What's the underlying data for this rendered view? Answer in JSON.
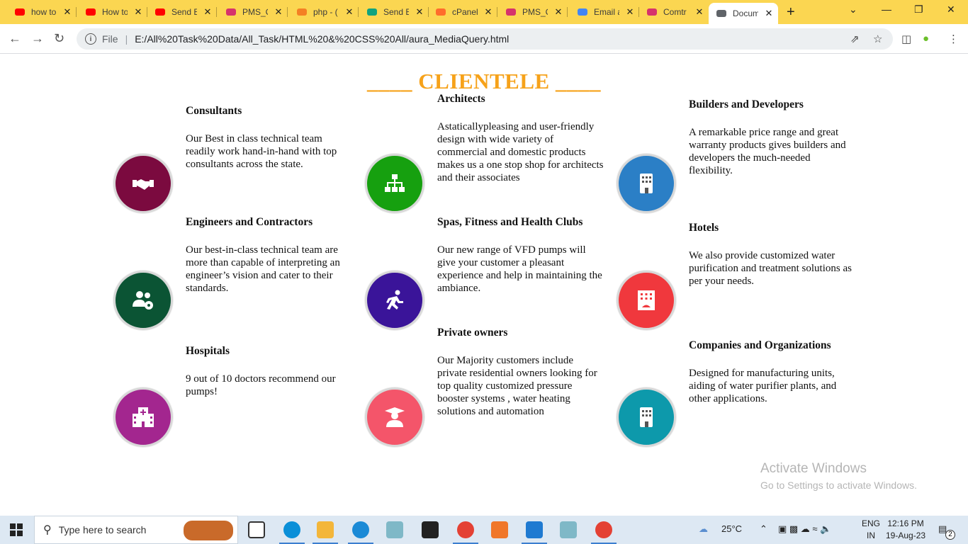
{
  "browser": {
    "tabs": [
      {
        "label": "how to",
        "icon": "youtube-icon",
        "color": "#ff0000"
      },
      {
        "label": "How to",
        "icon": "youtube-icon",
        "color": "#ff0000"
      },
      {
        "label": "Send E",
        "icon": "youtube-icon",
        "color": "#ff0000"
      },
      {
        "label": "PMS_C",
        "icon": "app-icon",
        "color": "#d6336c"
      },
      {
        "label": "php - (",
        "icon": "stackoverflow-icon",
        "color": "#f48024"
      },
      {
        "label": "Send E",
        "icon": "chatgpt-icon",
        "color": "#10a37f"
      },
      {
        "label": "cPanel",
        "icon": "cpanel-icon",
        "color": "#ff6c2c"
      },
      {
        "label": "PMS_C",
        "icon": "app-icon",
        "color": "#d6336c"
      },
      {
        "label": "Email a",
        "icon": "google-icon",
        "color": "#4285f4"
      },
      {
        "label": "Comtr",
        "icon": "app-icon",
        "color": "#d6336c"
      },
      {
        "label": "Docum",
        "icon": "globe-icon",
        "color": "#5f6368",
        "active": true
      }
    ],
    "address": {
      "scheme_label": "File",
      "url": "E:/All%20Task%20Data/All_Task/HTML%20&%20CSS%20All/aura_MediaQuery.html"
    }
  },
  "page": {
    "heading": "____ CLIENTELE ____",
    "accent_color": "#f6a21a",
    "clients": [
      {
        "title": "Consultants",
        "desc": "Our Best in class technical team readily work hand-in-hand with top consultants across the state.",
        "icon": "handshake-icon",
        "color": "#7b0a3f"
      },
      {
        "title": "Architects",
        "desc": "Astaticallypleasing and user-friendly design with wide variety of commercial and domestic products makes us a one stop shop for architects and their associates",
        "icon": "sitemap-icon",
        "color": "#16a00f"
      },
      {
        "title": "Builders and Developers",
        "desc": "A remarkable price range and great warranty products gives builders and developers the much-needed flexibility.",
        "icon": "building-icon",
        "color": "#2b7fc6"
      },
      {
        "title": "Engineers and Contractors",
        "desc": "Our best-in-class technical team are more than capable of interpreting an engineer’s vision and cater to their standards.",
        "icon": "users-cog-icon",
        "color": "#0b5434"
      },
      {
        "title": "Spas, Fitness and Health Clubs",
        "desc": "Our new range of VFD pumps will give your customer a pleasant experience and help in maintaining the ambiance.",
        "icon": "running-icon",
        "color": "#3a1499"
      },
      {
        "title": "Hotels",
        "desc": "We also provide customized water purification and treatment solutions as per your needs.",
        "icon": "hotel-icon",
        "color": "#f0383d"
      },
      {
        "title": "Hospitals",
        "desc": "9 out of 10 doctors recommend our pumps!",
        "icon": "hospital-icon",
        "color": "#a3268f"
      },
      {
        "title": "Private owners",
        "desc": "Our Majority customers include private residential owners looking for top quality customized pressure booster systems , water heating solutions and automation",
        "icon": "graduate-icon",
        "color": "#f4556a"
      },
      {
        "title": "Companies and Organizations",
        "desc": "Designed for manufacturing units, aiding of water purifier plants, and other applications.",
        "icon": "building-icon",
        "color": "#0d99ab"
      }
    ]
  },
  "watermark": {
    "title": "Activate Windows",
    "subtitle": "Go to Settings to activate Windows."
  },
  "taskbar": {
    "search_placeholder": "Type here to search",
    "weather": "25°C",
    "lang_top": "ENG",
    "lang_bottom": "IN",
    "time": "12:16 PM",
    "date": "19-Aug-23",
    "notification_count": "2"
  }
}
